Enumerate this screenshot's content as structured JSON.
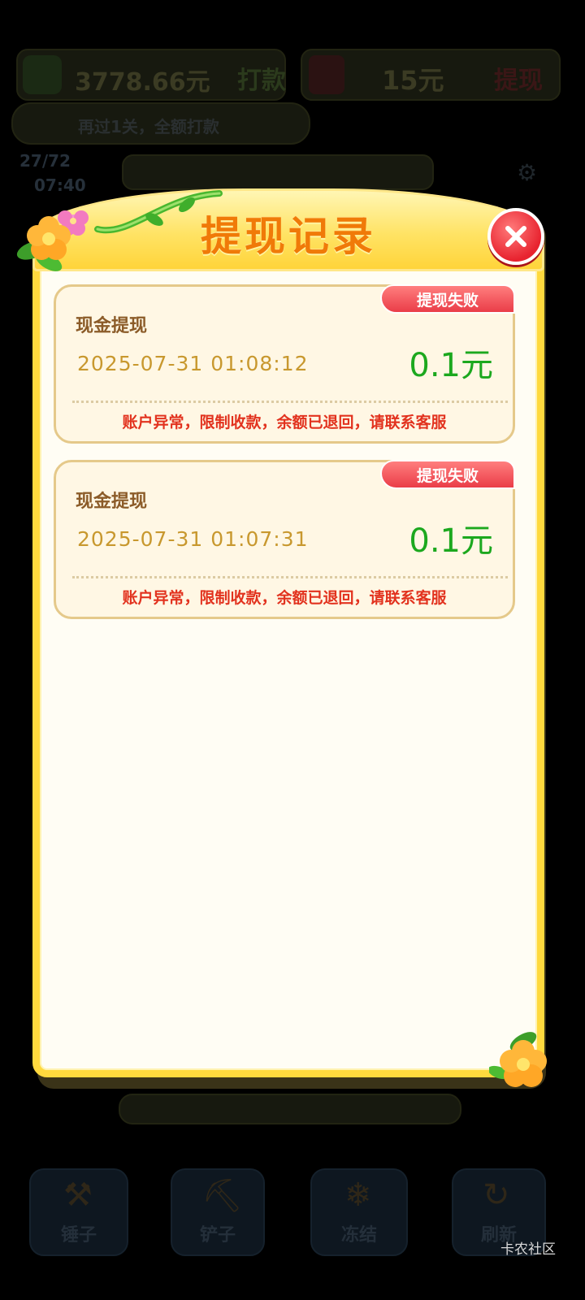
{
  "background": {
    "balance": "3778.66元",
    "payout_button": "打款",
    "redpacket_amount": "15元",
    "withdraw_button": "提现",
    "hint": "再过1关，全额打款",
    "level": "27/72",
    "timer": "07:40",
    "tools": [
      {
        "label": "锤子",
        "icon": "hammer-icon"
      },
      {
        "label": "铲子",
        "icon": "shovel-icon"
      },
      {
        "label": "冻结",
        "icon": "freeze-icon"
      },
      {
        "label": "刷新",
        "icon": "refresh-icon"
      }
    ]
  },
  "modal": {
    "title": "提现记录",
    "records": [
      {
        "type": "现金提现",
        "status": "提现失败",
        "time": "2025-07-31 01:08:12",
        "amount": "0.1元",
        "note": "账户异常，限制收款，余额已退回，请联系客服"
      },
      {
        "type": "现金提现",
        "status": "提现失败",
        "time": "2025-07-31 01:07:31",
        "amount": "0.1元",
        "note": "账户异常，限制收款，余额已退回，请联系客服"
      }
    ]
  },
  "watermark": "卡农社区",
  "colors": {
    "title": "#f07a08",
    "amount": "#1ca81e",
    "badge": "#ea3d48",
    "note": "#e2321e",
    "frame": "#ffd93e"
  }
}
